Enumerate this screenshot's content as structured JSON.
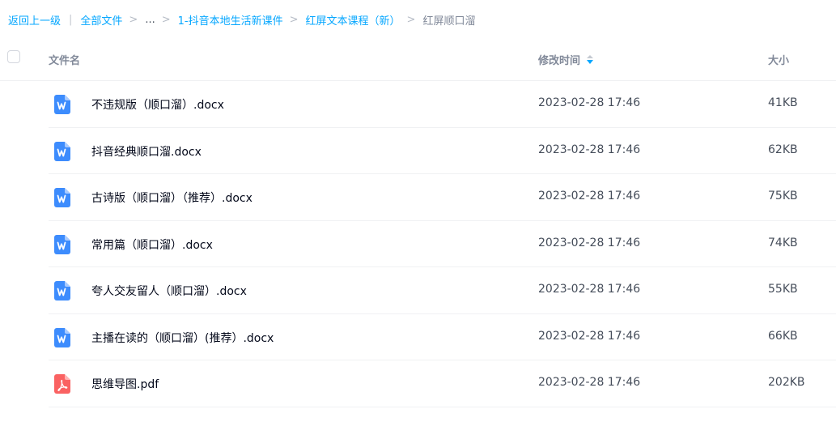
{
  "breadcrumb": {
    "back": "返回上一级",
    "all_files": "全部文件",
    "ellipsis": "...",
    "path": [
      "1-抖音本地生活新课件",
      "红屏文本课程（新）"
    ],
    "current": "红屏顺口溜"
  },
  "header": {
    "name_label": "文件名",
    "time_label": "修改时间",
    "size_label": "大小"
  },
  "colors": {
    "accent": "#06a7ff",
    "word_icon": "#3d8cfd",
    "pdf_icon": "#fa6262"
  },
  "files": [
    {
      "name": "不违规版（顺口溜）.docx",
      "time": "2023-02-28 17:46",
      "size": "41KB",
      "icon": "word-doc-icon"
    },
    {
      "name": "抖音经典顺口溜.docx",
      "time": "2023-02-28 17:46",
      "size": "62KB",
      "icon": "word-doc-icon"
    },
    {
      "name": "古诗版（顺口溜）（推荐）.docx",
      "time": "2023-02-28 17:46",
      "size": "75KB",
      "icon": "word-doc-icon"
    },
    {
      "name": "常用篇（顺口溜）.docx",
      "time": "2023-02-28 17:46",
      "size": "74KB",
      "icon": "word-doc-icon"
    },
    {
      "name": "夸人交友留人（顺口溜）.docx",
      "time": "2023-02-28 17:46",
      "size": "55KB",
      "icon": "word-doc-icon"
    },
    {
      "name": "主播在读的（顺口溜）(推荐）.docx",
      "time": "2023-02-28 17:46",
      "size": "66KB",
      "icon": "word-doc-icon"
    },
    {
      "name": "思维导图.pdf",
      "time": "2023-02-28 17:46",
      "size": "202KB",
      "icon": "pdf-icon"
    }
  ]
}
